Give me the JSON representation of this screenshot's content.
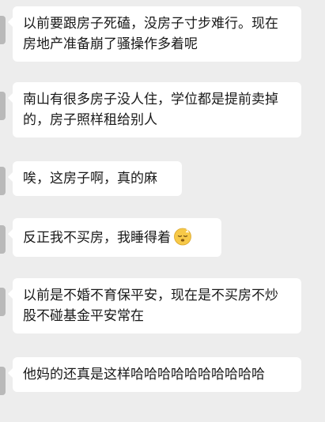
{
  "messages": [
    {
      "text": "以前要跟房子死磕，没房子寸步难行。现在房地产准备崩了骚操作多着呢"
    },
    {
      "text": "南山有很多房子没人住，学位都是提前卖掉的，房子照样租给别人"
    },
    {
      "text": "唉，这房子啊，真的麻"
    },
    {
      "text": "反正我不买房，我睡得着",
      "emoji": "sleeping-face-icon"
    },
    {
      "text": "以前是不婚不育保平安，现在是不买房不炒股不碰基金平安常在"
    },
    {
      "text": "他妈的还真是这样哈哈哈哈哈哈哈哈哈哈"
    }
  ],
  "colors": {
    "background": "#ededed",
    "bubble": "#ffffff",
    "text": "#191919",
    "avatar_stub": "#b9b9b9",
    "emoji_face": "#f7c948"
  }
}
